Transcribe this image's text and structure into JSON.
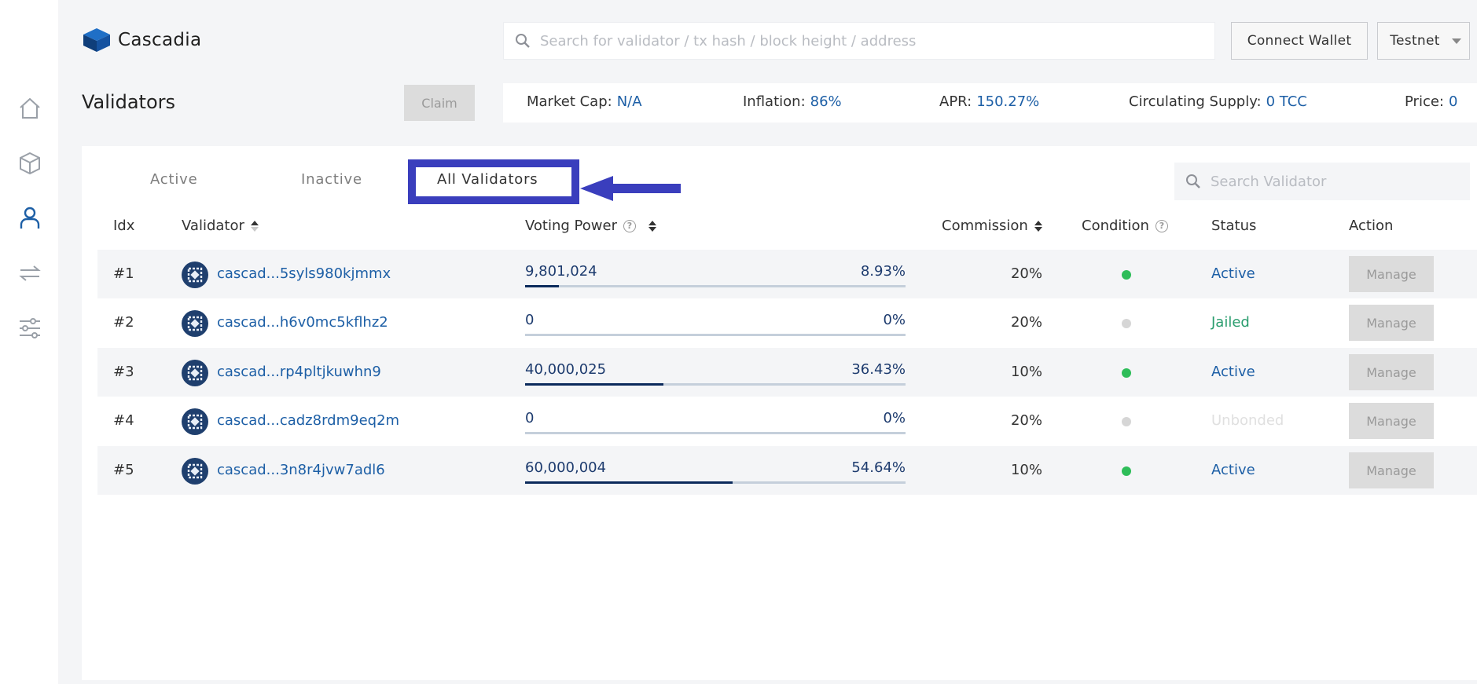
{
  "app": {
    "name": "Cascadia"
  },
  "nav": [
    {
      "name": "home-icon",
      "active": false
    },
    {
      "name": "blocks-icon",
      "active": false
    },
    {
      "name": "validators-icon",
      "active": true
    },
    {
      "name": "transactions-icon",
      "active": false
    },
    {
      "name": "params-icon",
      "active": false
    }
  ],
  "header": {
    "search_placeholder": "Search for validator / tx hash / block height / address",
    "connect_label": "Connect Wallet",
    "network_label": "Testnet"
  },
  "page": {
    "title": "Validators",
    "claim_label": "Claim"
  },
  "stats": {
    "market_cap_label": "Market Cap:",
    "market_cap": "N/A",
    "inflation_label": "Inflation:",
    "inflation": "86%",
    "apr_label": "APR:",
    "apr": "150.27%",
    "supply_label": "Circulating Supply:",
    "supply": "0 TCC",
    "price_label": "Price:",
    "price": "0"
  },
  "tabs": {
    "active": "Active",
    "inactive": "Inactive",
    "all": "All Validators",
    "selected": "all"
  },
  "validator_search_placeholder": "Search Validator",
  "columns": {
    "idx": "Idx",
    "validator": "Validator",
    "voting_power": "Voting Power",
    "commission": "Commission",
    "condition": "Condition",
    "status": "Status",
    "action": "Action"
  },
  "rows": [
    {
      "idx": "#1",
      "name": "cascad...5syls980kjmmx",
      "vp": "9,801,024",
      "pct": "8.93%",
      "share": 0.0893,
      "commission": "20%",
      "condition": "#2ebd59",
      "status": "Active",
      "status_color": "#1d5fa6",
      "action": "Manage"
    },
    {
      "idx": "#2",
      "name": "cascad...h6v0mc5kflhz2",
      "vp": "0",
      "pct": "0%",
      "share": 0,
      "commission": "20%",
      "condition": "#d6d6d6",
      "status": "Jailed",
      "status_color": "#2a9d6e",
      "action": "Manage"
    },
    {
      "idx": "#3",
      "name": "cascad...rp4pltjkuwhn9",
      "vp": "40,000,025",
      "pct": "36.43%",
      "share": 0.3643,
      "commission": "10%",
      "condition": "#2ebd59",
      "status": "Active",
      "status_color": "#1d5fa6",
      "action": "Manage"
    },
    {
      "idx": "#4",
      "name": "cascad...cadz8rdm9eq2m",
      "vp": "0",
      "pct": "0%",
      "share": 0,
      "commission": "20%",
      "condition": "#d6d6d6",
      "status": "Unbonded",
      "status_color": "#e0e0e0",
      "action": "Manage"
    },
    {
      "idx": "#5",
      "name": "cascad...3n8r4jvw7adl6",
      "vp": "60,000,004",
      "pct": "54.64%",
      "share": 0.5464,
      "commission": "10%",
      "condition": "#2ebd59",
      "status": "Active",
      "status_color": "#1d5fa6",
      "action": "Manage"
    }
  ]
}
